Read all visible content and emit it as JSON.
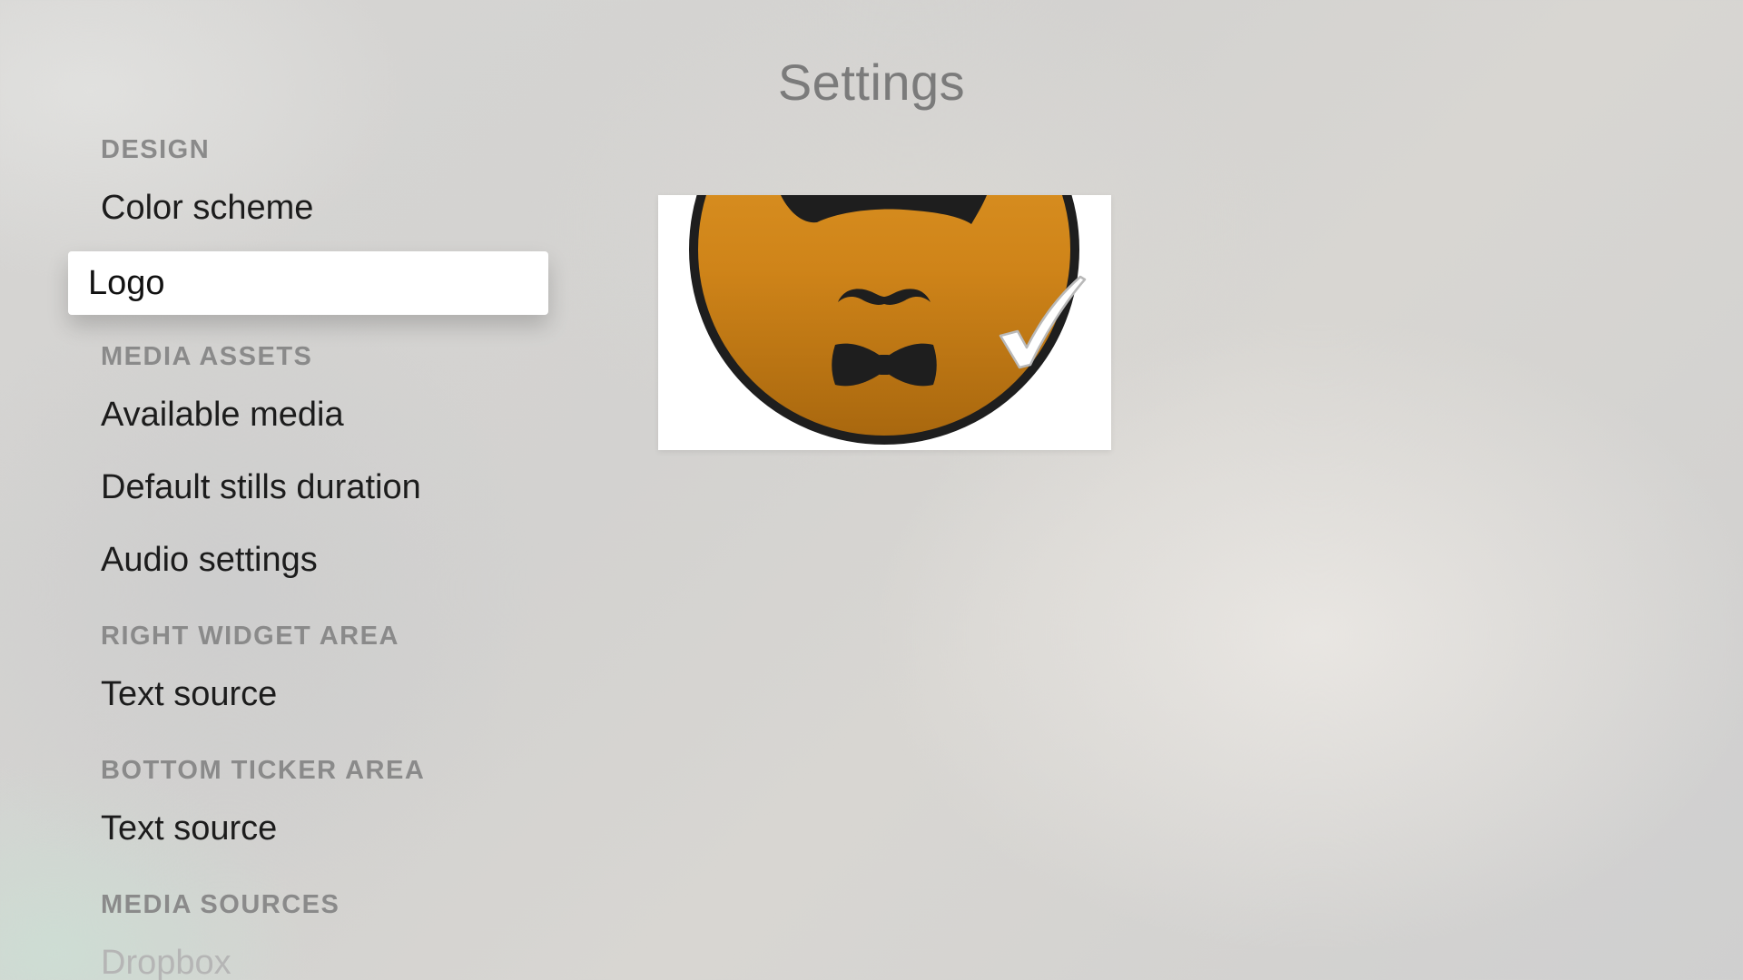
{
  "page": {
    "title": "Settings"
  },
  "menu": {
    "sections": [
      {
        "header": "DESIGN",
        "items": [
          "Color scheme",
          "Logo"
        ]
      },
      {
        "header": "MEDIA ASSETS",
        "items": [
          "Available media",
          "Default stills duration",
          "Audio settings"
        ]
      },
      {
        "header": "RIGHT WIDGET AREA",
        "items": [
          "Text source"
        ]
      },
      {
        "header": "BOTTOM TICKER AREA",
        "items": [
          "Text source"
        ]
      },
      {
        "header": "MEDIA SOURCES",
        "items": [
          "Dropbox"
        ]
      }
    ],
    "selected_item": "Logo"
  },
  "preview": {
    "image": "logo-mustache-bowtie",
    "selected": true,
    "colors": {
      "circle_top": "#e29a28",
      "circle_bottom": "#a8670e",
      "outline": "#1e1e1e"
    }
  }
}
